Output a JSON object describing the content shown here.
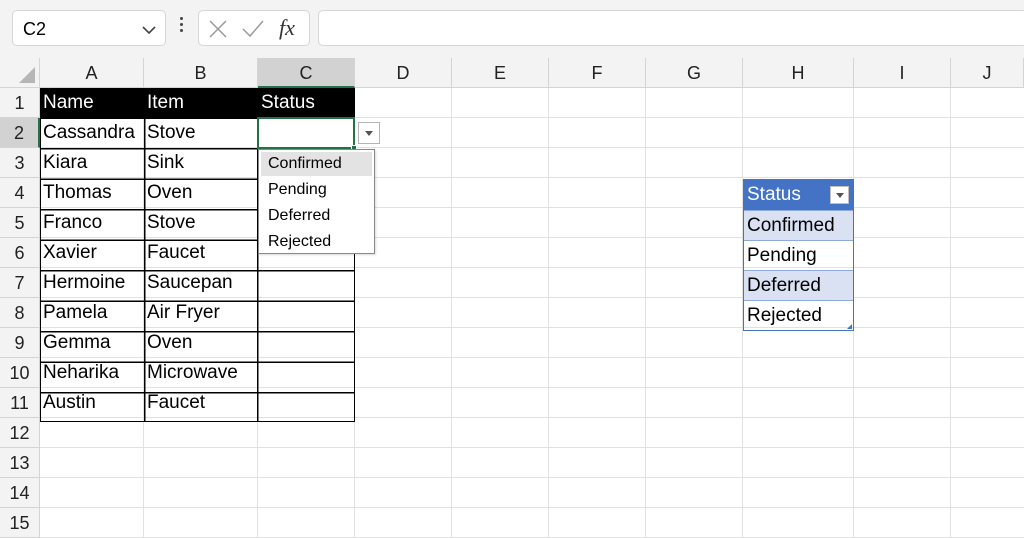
{
  "formula_bar": {
    "name_box": "C2",
    "fx_label": "fx",
    "formula": ""
  },
  "columns": [
    "A",
    "B",
    "C",
    "D",
    "E",
    "F",
    "G",
    "H",
    "I",
    "J"
  ],
  "rows": [
    "1",
    "2",
    "3",
    "4",
    "5",
    "6",
    "7",
    "8",
    "9",
    "10",
    "11",
    "12",
    "13",
    "14",
    "15"
  ],
  "selection": {
    "column": "C",
    "row": "2"
  },
  "table": {
    "headers": [
      "Name",
      "Item",
      "Status"
    ],
    "rows": [
      {
        "name": "Cassandra",
        "item": "Stove"
      },
      {
        "name": "Kiara",
        "item": "Sink"
      },
      {
        "name": "Thomas",
        "item": "Oven"
      },
      {
        "name": "Franco",
        "item": "Stove"
      },
      {
        "name": "Xavier",
        "item": "Faucet"
      },
      {
        "name": "Hermoine",
        "item": "Saucepan"
      },
      {
        "name": "Pamela",
        "item": "Air Fryer"
      },
      {
        "name": "Gemma",
        "item": "Oven"
      },
      {
        "name": "Neharika",
        "item": "Microwave"
      },
      {
        "name": "Austin",
        "item": "Faucet"
      }
    ]
  },
  "dropdown": {
    "options": [
      "Confirmed",
      "Pending",
      "Deferred",
      "Rejected"
    ],
    "highlighted": "Confirmed"
  },
  "status_list": {
    "header": "Status",
    "items": [
      "Confirmed",
      "Pending",
      "Deferred",
      "Rejected"
    ]
  },
  "colors": {
    "selection_green": "#217346",
    "table_blue": "#4472c4",
    "table_band": "#d9e1f2",
    "header_black": "#000000"
  }
}
